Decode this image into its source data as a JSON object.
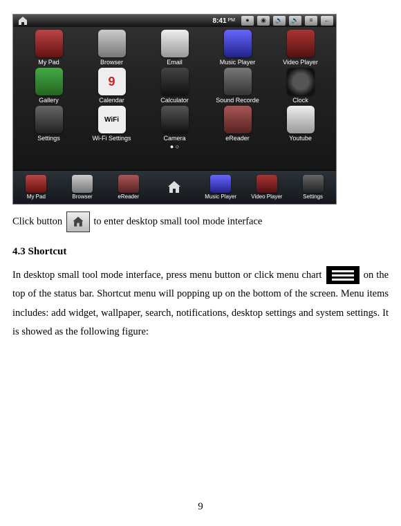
{
  "statusbar": {
    "time": "8:41",
    "ampm": "PM",
    "icons": [
      "mic",
      "camera",
      "vol-down",
      "vol-up",
      "menu",
      "back"
    ]
  },
  "rows": [
    [
      {
        "k": "mypad",
        "label": "My Pad"
      },
      {
        "k": "browser",
        "label": "Browser"
      },
      {
        "k": "email",
        "label": "Email"
      },
      {
        "k": "music",
        "label": "Music Player"
      },
      {
        "k": "video",
        "label": "Video Player"
      }
    ],
    [
      {
        "k": "gallery",
        "label": "Gallery"
      },
      {
        "k": "calendar",
        "label": "Calendar",
        "glyph": "9"
      },
      {
        "k": "calc",
        "label": "Calculator"
      },
      {
        "k": "record",
        "label": "Sound Recorde"
      },
      {
        "k": "clock",
        "label": "Clock"
      }
    ],
    [
      {
        "k": "settings",
        "label": "Settings"
      },
      {
        "k": "wifi",
        "label": "Wi-Fi Settings",
        "glyph": "WiFi"
      },
      {
        "k": "camera",
        "label": "Camera"
      },
      {
        "k": "ereader",
        "label": "eReader"
      },
      {
        "k": "youtube",
        "label": "Youtube"
      }
    ]
  ],
  "dock": [
    {
      "k": "mypad",
      "label": "My Pad"
    },
    {
      "k": "browser",
      "label": "Browser"
    },
    {
      "k": "ereader",
      "label": "eReader"
    },
    {
      "k": "home",
      "label": "",
      "nobg": true
    },
    {
      "k": "music",
      "label": "Music Player"
    },
    {
      "k": "video",
      "label": "Video Player"
    },
    {
      "k": "settings",
      "label": "Settings"
    }
  ],
  "text": {
    "line1a": "Click button",
    "line1b": "to enter desktop small tool mode interface",
    "heading": "4.3 Shortcut",
    "para_a": "In desktop small tool mode interface, press menu button or click menu chart",
    "para_b": "on the top of the status bar. Shortcut menu will popping up on the bottom of the screen. Menu items includes: add widget, wallpaper, search, notifications, desktop settings and system settings. It is showed as the following figure:",
    "page": "9"
  }
}
